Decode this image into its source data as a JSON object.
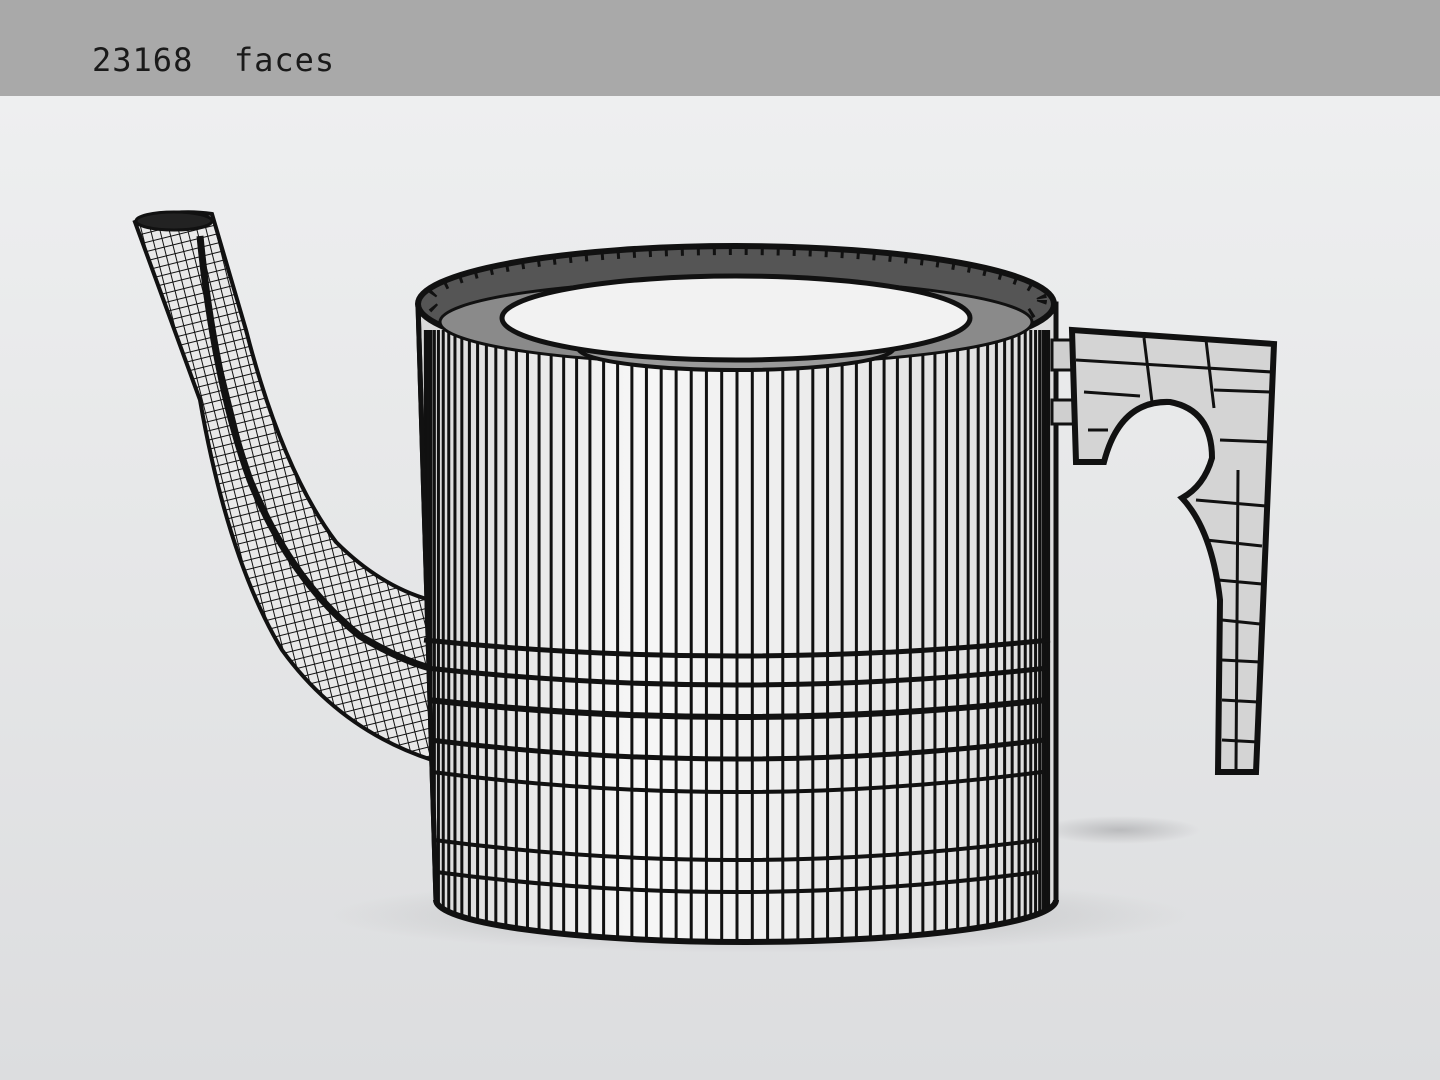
{
  "stats": {
    "face_count": "23168",
    "face_label": "faces"
  },
  "viewport": {
    "background_color": "#e6e7e8",
    "stats_bar_color": "#a9a9a9",
    "wire_color": "#111111",
    "shading_color": "#f4f4f4",
    "model": "teapot-wireframe"
  }
}
